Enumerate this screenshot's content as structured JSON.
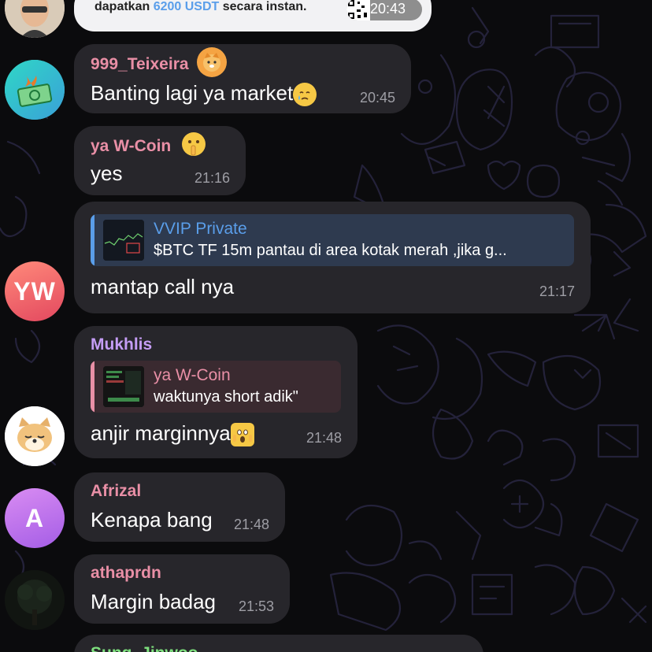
{
  "top_bubble": {
    "text_pre": "dapatkan",
    "amount": "6200 USDT",
    "text_post": "secara instan.",
    "time": "20:43"
  },
  "messages": [
    {
      "sender": "999_Teixeira",
      "sender_color": "#e98fa6",
      "badge_icon": "shiba-emoji",
      "text": "Banting lagi ya market",
      "inline_icon": "crying-face-emoji",
      "time": "20:45"
    },
    {
      "sender": "ya W-Coin",
      "sender_color": "#e98fa6",
      "badge_icon": "shushing-face-emoji",
      "text": "yes",
      "time": "21:16"
    },
    {
      "avatar_initials": "YW",
      "reply_name": "VVIP Private",
      "reply_text": "$BTC TF 15m pantau di area kotak merah ,jika g...",
      "reply_color": "#5a9eea",
      "text": "mantap call nya",
      "time": "21:17"
    },
    {
      "sender": "Mukhlis",
      "sender_color": "#c59df5",
      "reply_name": "ya W-Coin",
      "reply_text": "waktunya short adik\"",
      "reply_color": "#e98fa6",
      "text": "anjir marginnya",
      "inline_icon": "screaming-face-emoji",
      "time": "21:48"
    },
    {
      "avatar_initials": "A",
      "sender": "Afrizal",
      "sender_color": "#e98fa6",
      "text": "Kenapa bang",
      "time": "21:48"
    },
    {
      "sender": "athaprdn",
      "sender_color": "#e98fa6",
      "text": "Margin badag",
      "time": "21:53"
    },
    {
      "sender": "Sung_Jinwoo",
      "sender_color": "#7ee07e"
    }
  ],
  "colors": {
    "bubble": "#27262b",
    "background": "#0b0b0d",
    "time": "#9e9ea5",
    "usdt": "#5a9eea"
  }
}
